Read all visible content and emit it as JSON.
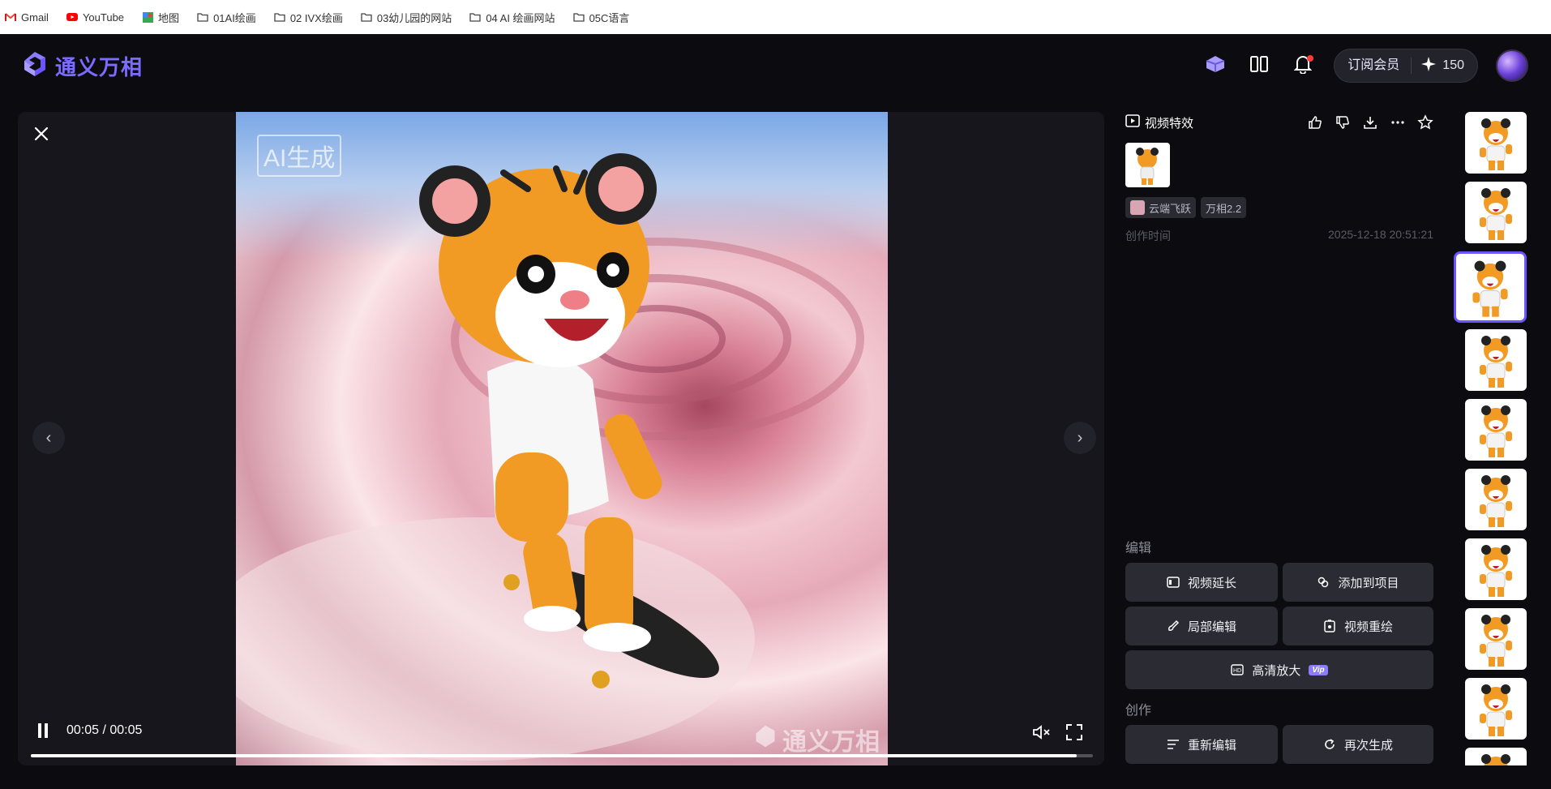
{
  "bookmarks": [
    {
      "label": "Gmail",
      "icon": "gmail-icon"
    },
    {
      "label": "YouTube",
      "icon": "youtube-icon"
    },
    {
      "label": "地图",
      "icon": "maps-icon"
    },
    {
      "label": "01AI绘画",
      "icon": "folder-icon"
    },
    {
      "label": "02 IVX绘画",
      "icon": "folder-icon"
    },
    {
      "label": "03幼儿园的网站",
      "icon": "folder-icon"
    },
    {
      "label": "04 AI 绘画网站",
      "icon": "folder-icon"
    },
    {
      "label": "05C语言",
      "icon": "folder-icon"
    }
  ],
  "header": {
    "logo_text": "通义万相",
    "subscribe_label": "订阅会员",
    "points": "150",
    "brand_color": "#7b6cff"
  },
  "player": {
    "ai_badge": "AI生成",
    "watermark": "通义万相",
    "time": "00:05 / 00:05",
    "progress_fraction": 0.985,
    "prev_symbol": "‹",
    "next_symbol": "›"
  },
  "info": {
    "title": "视频特效",
    "author": "云端飞跃",
    "model": "万相2.2",
    "created_label": "创作时间",
    "created_value": "2025-12-18 20:51:21",
    "edit_section": "编辑",
    "create_section": "创作",
    "buttons": {
      "extend": "视频延长",
      "add_project": "添加到项目",
      "partial_edit": "局部编辑",
      "repaint": "视频重绘",
      "upscale": "高清放大",
      "upscale_badge": "Vip",
      "reedit": "重新编辑",
      "regenerate": "再次生成"
    }
  },
  "thumbnails_count": 10,
  "selected_thumbnail": 2
}
